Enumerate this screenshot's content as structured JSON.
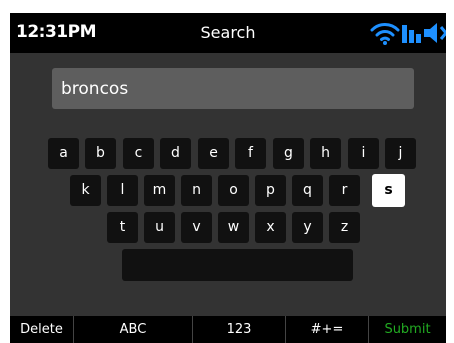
{
  "status_bar": {
    "time": "12:31PM",
    "title": "Search",
    "icons": [
      "wifi-icon",
      "signal-bars-icon",
      "volume-icon"
    ]
  },
  "search": {
    "value": "broncos"
  },
  "keyboard": {
    "row1": [
      "a",
      "b",
      "c",
      "d",
      "e",
      "f",
      "g",
      "h",
      "i",
      "j"
    ],
    "row2": [
      "k",
      "l",
      "m",
      "n",
      "o",
      "p",
      "q",
      "r",
      "s"
    ],
    "row3": [
      "t",
      "u",
      "v",
      "w",
      "x",
      "y",
      "z"
    ],
    "selected_key": "s"
  },
  "softkeys": {
    "delete": "Delete",
    "abc": "ABC",
    "numbers": "123",
    "symbols": "#+=",
    "submit": "Submit"
  },
  "colors": {
    "accent_icon": "#1e90ff",
    "submit": "#22aa22",
    "screen_bg": "#333333",
    "key_bg": "#111111",
    "selected_key_bg": "#ffffff"
  }
}
